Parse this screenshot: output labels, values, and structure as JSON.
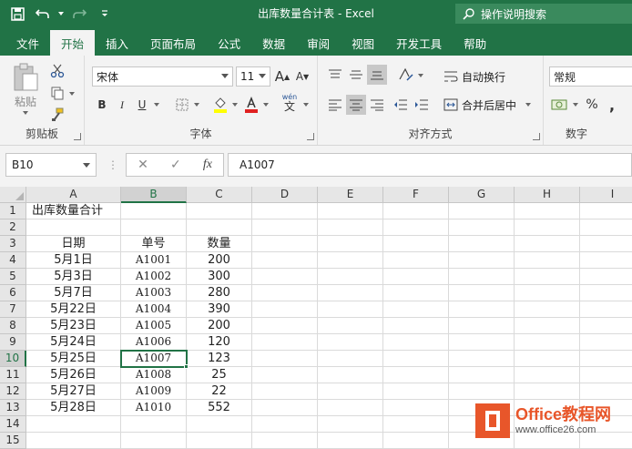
{
  "window": {
    "title": "出库数量合计表  -  Excel"
  },
  "tell_me": {
    "placeholder": "操作说明搜索"
  },
  "tabs": [
    "文件",
    "开始",
    "插入",
    "页面布局",
    "公式",
    "数据",
    "审阅",
    "视图",
    "开发工具",
    "帮助"
  ],
  "active_tab": "开始",
  "ribbon": {
    "clipboard": {
      "label": "剪贴板",
      "paste_label": "粘贴"
    },
    "font": {
      "label": "字体",
      "font_name": "宋体",
      "font_size": "11",
      "bold": "B",
      "italic": "I",
      "underline": "U",
      "grow": "A",
      "shrink": "A",
      "wen": "wén",
      "wen_sub": "文"
    },
    "alignment": {
      "label": "对齐方式",
      "wrap_text": "自动换行",
      "merge_center": "合并后居中"
    },
    "number": {
      "label": "数字",
      "format": "常规",
      "percent": "%",
      "comma": ","
    }
  },
  "formula_bar": {
    "name_box": "B10",
    "fx": "fx",
    "content": "A1007"
  },
  "colors": {
    "accent": "#217346",
    "watermark": "#e8562a"
  },
  "grid": {
    "columns": [
      "A",
      "B",
      "C",
      "D",
      "E",
      "F",
      "G",
      "H",
      "I"
    ],
    "selected_column": "B",
    "selected_row": "10",
    "rows": [
      {
        "num": "1",
        "a": "出库数量合计",
        "b": "",
        "c": ""
      },
      {
        "num": "2",
        "a": "",
        "b": "",
        "c": ""
      },
      {
        "num": "3",
        "a": "日期",
        "b": "单号",
        "c": "数量"
      },
      {
        "num": "4",
        "a": "5月1日",
        "b": "A1001",
        "c": "200"
      },
      {
        "num": "5",
        "a": "5月3日",
        "b": "A1002",
        "c": "300"
      },
      {
        "num": "6",
        "a": "5月7日",
        "b": "A1003",
        "c": "280"
      },
      {
        "num": "7",
        "a": "5月22日",
        "b": "A1004",
        "c": "390"
      },
      {
        "num": "8",
        "a": "5月23日",
        "b": "A1005",
        "c": "200"
      },
      {
        "num": "9",
        "a": "5月24日",
        "b": "A1006",
        "c": "120"
      },
      {
        "num": "10",
        "a": "5月25日",
        "b": "A1007",
        "c": "123"
      },
      {
        "num": "11",
        "a": "5月26日",
        "b": "A1008",
        "c": "25"
      },
      {
        "num": "12",
        "a": "5月27日",
        "b": "A1009",
        "c": "22"
      },
      {
        "num": "13",
        "a": "5月28日",
        "b": "A1010",
        "c": "552"
      },
      {
        "num": "14",
        "a": "",
        "b": "",
        "c": ""
      },
      {
        "num": "15",
        "a": "",
        "b": "",
        "c": ""
      }
    ]
  },
  "watermark": {
    "line1": "Office教程网",
    "line2": "www.office26.com"
  }
}
